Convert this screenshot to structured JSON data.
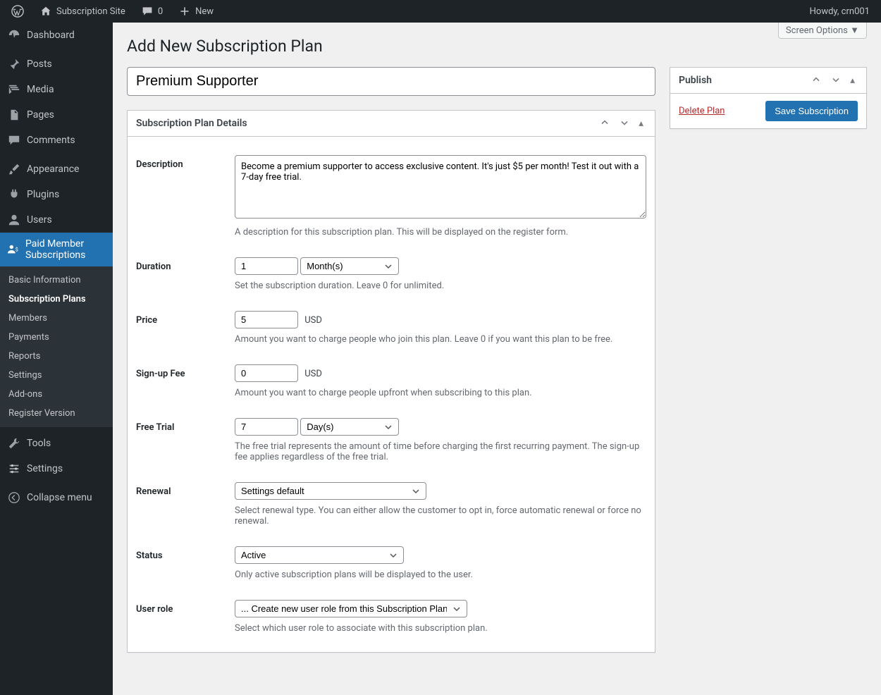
{
  "adminbar": {
    "site_name": "Subscription Site",
    "comments_count": "0",
    "new_label": "New",
    "howdy": "Howdy, crn001"
  },
  "sidebar": {
    "items": [
      {
        "label": "Dashboard",
        "icon": "dashboard"
      },
      {
        "label": "Posts",
        "icon": "pin"
      },
      {
        "label": "Media",
        "icon": "media"
      },
      {
        "label": "Pages",
        "icon": "pages"
      },
      {
        "label": "Comments",
        "icon": "comment"
      },
      {
        "label": "Appearance",
        "icon": "brush"
      },
      {
        "label": "Plugins",
        "icon": "plug"
      },
      {
        "label": "Users",
        "icon": "user"
      },
      {
        "label": "Paid Member Subscriptions",
        "icon": "pms",
        "current": true
      },
      {
        "label": "Tools",
        "icon": "wrench"
      },
      {
        "label": "Settings",
        "icon": "sliders"
      },
      {
        "label": "Collapse menu",
        "icon": "collapse"
      }
    ],
    "submenu": [
      {
        "label": "Basic Information"
      },
      {
        "label": "Subscription Plans",
        "current": true
      },
      {
        "label": "Members"
      },
      {
        "label": "Payments"
      },
      {
        "label": "Reports"
      },
      {
        "label": "Settings"
      },
      {
        "label": "Add-ons"
      },
      {
        "label": "Register Version"
      }
    ]
  },
  "screen_options_label": "Screen Options",
  "page_title": "Add New Subscription Plan",
  "title_value": "Premium Supporter",
  "details": {
    "panel_title": "Subscription Plan Details",
    "description": {
      "label": "Description",
      "value": "Become a premium supporter to access exclusive content. It's just $5 per month! Test it out with a 7-day free trial.",
      "help": "A description for this subscription plan. This will be displayed on the register form."
    },
    "duration": {
      "label": "Duration",
      "value": "1",
      "unit": "Month(s)",
      "help": "Set the subscription duration. Leave 0 for unlimited."
    },
    "price": {
      "label": "Price",
      "value": "5",
      "currency": "USD",
      "help": "Amount you want to charge people who join this plan. Leave 0 if you want this plan to be free."
    },
    "signup_fee": {
      "label": "Sign-up Fee",
      "value": "0",
      "currency": "USD",
      "help": "Amount you want to charge people upfront when subscribing to this plan."
    },
    "free_trial": {
      "label": "Free Trial",
      "value": "7",
      "unit": "Day(s)",
      "help": "The free trial represents the amount of time before charging the first recurring payment. The sign-up fee applies regardless of the free trial."
    },
    "renewal": {
      "label": "Renewal",
      "value": "Settings default",
      "help": "Select renewal type. You can either allow the customer to opt in, force automatic renewal or force no renewal."
    },
    "status": {
      "label": "Status",
      "value": "Active",
      "help": "Only active subscription plans will be displayed to the user."
    },
    "user_role": {
      "label": "User role",
      "value": "... Create new user role from this Subscription Plan",
      "help": "Select which user role to associate with this subscription plan."
    }
  },
  "publish": {
    "panel_title": "Publish",
    "delete_label": "Delete Plan",
    "save_label": "Save Subscription"
  }
}
